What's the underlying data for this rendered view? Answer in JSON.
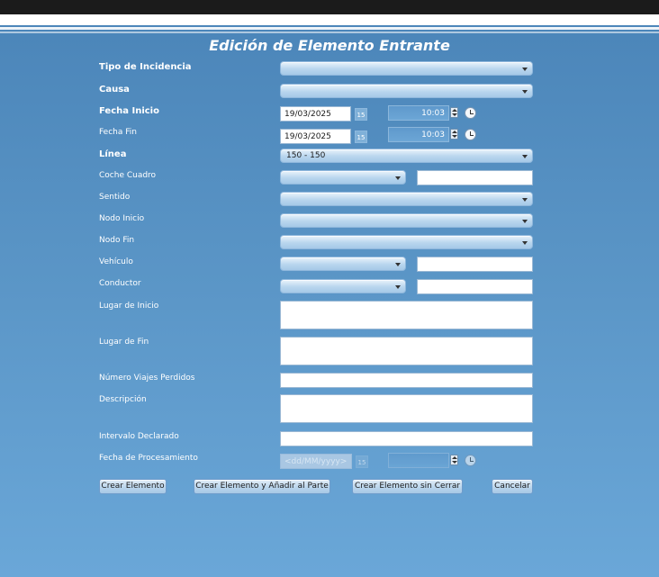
{
  "title": "Edición de Elemento Entrante",
  "fields": {
    "tipo_incidencia": {
      "label": "Tipo de Incidencia",
      "value": ""
    },
    "causa": {
      "label": "Causa",
      "value": ""
    },
    "fecha_inicio": {
      "label": "Fecha Inicio",
      "date": "19/03/2025",
      "time": "10:03"
    },
    "fecha_fin": {
      "label": "Fecha Fin",
      "date": "19/03/2025",
      "time": "10:03"
    },
    "linea": {
      "label": "Línea",
      "value": "150 - 150"
    },
    "coche_cuadro": {
      "label": "Coche Cuadro",
      "value": "",
      "text": ""
    },
    "sentido": {
      "label": "Sentido",
      "value": ""
    },
    "nodo_inicio": {
      "label": "Nodo Inicio",
      "value": ""
    },
    "nodo_fin": {
      "label": "Nodo Fin",
      "value": ""
    },
    "vehiculo": {
      "label": "Vehículo",
      "value": "",
      "text": ""
    },
    "conductor": {
      "label": "Conductor",
      "value": "",
      "text": ""
    },
    "lugar_inicio": {
      "label": "Lugar de Inicio",
      "value": ""
    },
    "lugar_fin": {
      "label": "Lugar de Fin",
      "value": ""
    },
    "numero_viajes": {
      "label": "Número Viajes Perdidos",
      "value": ""
    },
    "descripcion": {
      "label": "Descripción",
      "value": ""
    },
    "intervalo": {
      "label": "Intervalo Declarado",
      "value": ""
    },
    "fecha_procesamiento": {
      "label": "Fecha de Procesamiento",
      "placeholder": "<dd/MM/yyyy>",
      "time": ""
    }
  },
  "calendar_icon_text": "15",
  "buttons": {
    "crear": "Crear Elemento",
    "crear_anadir": "Crear Elemento y Añadir al Parte",
    "crear_sin_cerrar": "Crear Elemento sin Cerrar",
    "cancelar": "Cancelar"
  },
  "colors": {
    "background_top": "#4a84b8",
    "background_bottom": "#6aa7d8",
    "top_bar": "#1b1b1b",
    "title_text": "#ffffff"
  }
}
